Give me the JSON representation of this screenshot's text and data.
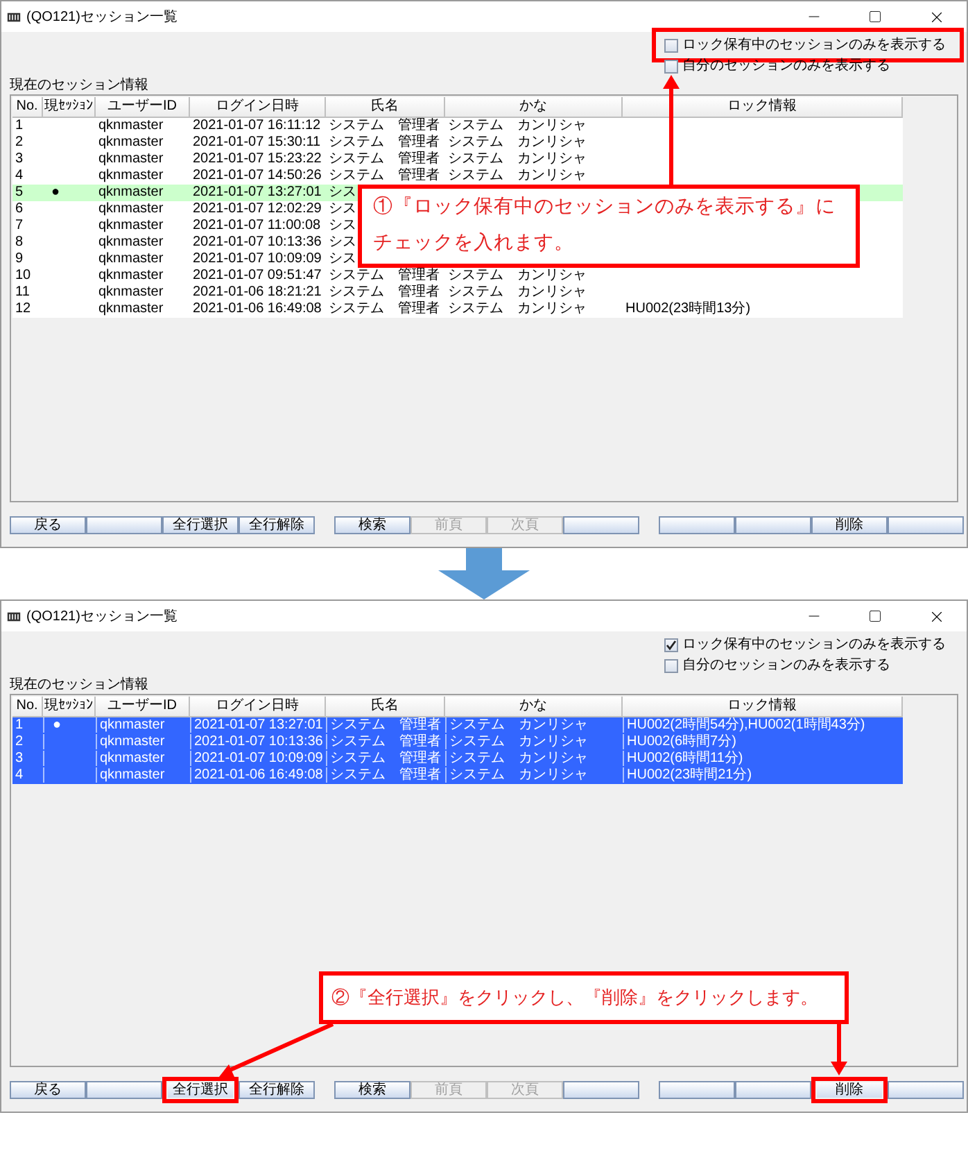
{
  "windows": [
    {
      "title": "(QO121)セッション一覧",
      "filters": [
        {
          "label": "ロック保有中のセッションのみを表示する",
          "checked": false,
          "highlighted": true
        },
        {
          "label": "自分のセッションのみを表示する",
          "checked": false,
          "highlighted": false
        }
      ],
      "section_label": "現在のセッション情報",
      "table": {
        "focused": false,
        "columns": [
          "No.",
          "現ｾｯｼｮﾝ",
          "ユーザーID",
          "ログイン日時",
          "氏名",
          "かな",
          "ロック情報"
        ],
        "rows": [
          {
            "no": "1",
            "user_id": "qknmaster",
            "login": "2021-01-07 16:11:12",
            "name": "システム　管理者",
            "kana": "システム　カンリシャ",
            "selected": false
          },
          {
            "no": "2",
            "user_id": "qknmaster",
            "login": "2021-01-07 15:30:11",
            "name": "システム　管理者",
            "kana": "システム　カンリシャ",
            "selected": false
          },
          {
            "no": "3",
            "user_id": "qknmaster",
            "login": "2021-01-07 15:23:22",
            "name": "システム　管理者",
            "kana": "システム　カンリシャ",
            "selected": false
          },
          {
            "no": "4",
            "user_id": "qknmaster",
            "login": "2021-01-07 14:50:26",
            "name": "システム　管理者",
            "kana": "システム　カンリシャ",
            "selected": false
          },
          {
            "no": "5",
            "current": "●",
            "user_id": "qknmaster",
            "login": "2021-01-07 13:27:01",
            "name": "シス",
            "selected": true
          },
          {
            "no": "6",
            "user_id": "qknmaster",
            "login": "2021-01-07 12:02:29",
            "name": "シス",
            "selected": false
          },
          {
            "no": "7",
            "user_id": "qknmaster",
            "login": "2021-01-07 11:00:08",
            "name": "シス",
            "selected": false
          },
          {
            "no": "8",
            "user_id": "qknmaster",
            "login": "2021-01-07 10:13:36",
            "name": "シス",
            "selected": false
          },
          {
            "no": "9",
            "user_id": "qknmaster",
            "login": "2021-01-07 10:09:09",
            "name": "シス",
            "selected": false
          },
          {
            "no": "10",
            "user_id": "qknmaster",
            "login": "2021-01-07 09:51:47",
            "name": "システム　管理者",
            "kana": "システム　カンリシャ",
            "selected": false
          },
          {
            "no": "11",
            "user_id": "qknmaster",
            "login": "2021-01-06 18:21:21",
            "name": "システム　管理者",
            "kana": "システム　カンリシャ",
            "selected": false
          },
          {
            "no": "12",
            "user_id": "qknmaster",
            "login": "2021-01-06 16:49:08",
            "name": "システム　管理者",
            "kana": "システム　カンリシャ",
            "lock": "HU002(23時間13分)",
            "selected": false
          }
        ]
      },
      "button_groups": [
        [
          {
            "label": "戻る",
            "disabled": false,
            "highlighted": false
          },
          {
            "disabled": false,
            "highlighted": false
          },
          {
            "label": "全行選択",
            "disabled": false,
            "highlighted": false
          },
          {
            "label": "全行解除",
            "disabled": false,
            "highlighted": false
          }
        ],
        [
          {
            "label": "検索",
            "disabled": false,
            "highlighted": false
          },
          {
            "label": "前頁",
            "disabled": true,
            "highlighted": false
          },
          {
            "label": "次頁",
            "disabled": true,
            "highlighted": false
          },
          {
            "disabled": false,
            "highlighted": false
          }
        ],
        [
          {
            "disabled": false,
            "highlighted": false
          },
          {
            "disabled": false,
            "highlighted": false
          },
          {
            "label": "削除",
            "disabled": false,
            "highlighted": false
          },
          {
            "disabled": false,
            "highlighted": false
          }
        ]
      ]
    },
    {
      "title": "(QO121)セッション一覧",
      "filters": [
        {
          "label": "ロック保有中のセッションのみを表示する",
          "checked": true,
          "highlighted": false
        },
        {
          "label": "自分のセッションのみを表示する",
          "checked": false,
          "highlighted": false
        }
      ],
      "section_label": "現在のセッション情報",
      "table": {
        "focused": true,
        "columns": [
          "No.",
          "現ｾｯｼｮﾝ",
          "ユーザーID",
          "ログイン日時",
          "氏名",
          "かな",
          "ロック情報"
        ],
        "rows": [
          {
            "no": "1",
            "current": "●",
            "user_id": "qknmaster",
            "login": "2021-01-07 13:27:01",
            "name": "システム　管理者",
            "kana": "システム　カンリシャ",
            "lock": "HU002(2時間54分),HU002(1時間43分)",
            "selected": true
          },
          {
            "no": "2",
            "user_id": "qknmaster",
            "login": "2021-01-07 10:13:36",
            "name": "システム　管理者",
            "kana": "システム　カンリシャ",
            "lock": "HU002(6時間7分)",
            "selected": true
          },
          {
            "no": "3",
            "user_id": "qknmaster",
            "login": "2021-01-07 10:09:09",
            "name": "システム　管理者",
            "kana": "システム　カンリシャ",
            "lock": "HU002(6時間11分)",
            "selected": true
          },
          {
            "no": "4",
            "user_id": "qknmaster",
            "login": "2021-01-06 16:49:08",
            "name": "システム　管理者",
            "kana": "システム　カンリシャ",
            "lock": "HU002(23時間21分)",
            "selected": true
          }
        ]
      },
      "button_groups": [
        [
          {
            "label": "戻る",
            "disabled": false,
            "highlighted": false
          },
          {
            "disabled": false,
            "highlighted": false
          },
          {
            "label": "全行選択",
            "disabled": false,
            "highlighted": true
          },
          {
            "label": "全行解除",
            "disabled": false,
            "highlighted": false
          }
        ],
        [
          {
            "label": "検索",
            "disabled": false,
            "highlighted": false
          },
          {
            "label": "前頁",
            "disabled": true,
            "highlighted": false
          },
          {
            "label": "次頁",
            "disabled": true,
            "highlighted": false
          },
          {
            "disabled": false,
            "highlighted": false
          }
        ],
        [
          {
            "disabled": false,
            "highlighted": false
          },
          {
            "disabled": false,
            "highlighted": false
          },
          {
            "label": "削除",
            "disabled": false,
            "highlighted": true
          },
          {
            "disabled": false,
            "highlighted": false
          }
        ]
      ]
    }
  ],
  "callouts": [
    "①『ロック保有中のセッションのみを表示する』にチェックを入れます。",
    "②『全行選択』をクリックし、『削除』をクリックします。"
  ]
}
